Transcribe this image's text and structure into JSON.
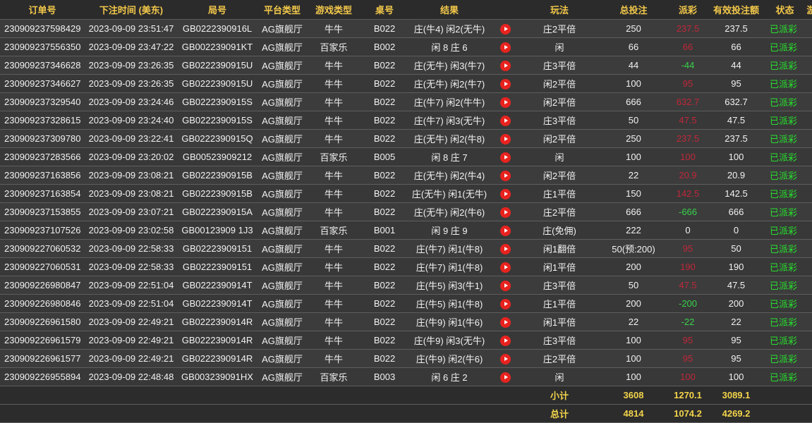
{
  "columns": [
    "订单号",
    "下注时间 (美东)",
    "局号",
    "平台类型",
    "游戏类型",
    "桌号",
    "结果",
    "",
    "玩法",
    "总投注",
    "派彩",
    "有效投注额",
    "状态",
    "游"
  ],
  "rows": [
    {
      "order": "230909237598429",
      "time": "2023-09-09 23:51:47",
      "round": "GB0222390916L",
      "platform": "AG旗舰厅",
      "game": "牛牛",
      "table": "B022",
      "result": "庄(牛4) 闲2(无牛)",
      "play": "庄2平倍",
      "bet": "250",
      "payout": "237.5",
      "payout_sign": "pos",
      "valid": "237.5",
      "status": "已派彩"
    },
    {
      "order": "230909237556350",
      "time": "2023-09-09 23:47:22",
      "round": "GB002239091KT",
      "platform": "AG旗舰厅",
      "game": "百家乐",
      "table": "B002",
      "result": "闲 8 庄 6",
      "play": "闲",
      "bet": "66",
      "payout": "66",
      "payout_sign": "pos",
      "valid": "66",
      "status": "已派彩"
    },
    {
      "order": "230909237346628",
      "time": "2023-09-09 23:26:35",
      "round": "GB0222390915U",
      "platform": "AG旗舰厅",
      "game": "牛牛",
      "table": "B022",
      "result": "庄(无牛) 闲3(牛7)",
      "play": "庄3平倍",
      "bet": "44",
      "payout": "-44",
      "payout_sign": "neg",
      "valid": "44",
      "status": "已派彩"
    },
    {
      "order": "230909237346627",
      "time": "2023-09-09 23:26:35",
      "round": "GB0222390915U",
      "platform": "AG旗舰厅",
      "game": "牛牛",
      "table": "B022",
      "result": "庄(无牛) 闲2(牛7)",
      "play": "闲2平倍",
      "bet": "100",
      "payout": "95",
      "payout_sign": "pos",
      "valid": "95",
      "status": "已派彩"
    },
    {
      "order": "230909237329540",
      "time": "2023-09-09 23:24:46",
      "round": "GB0222390915S",
      "platform": "AG旗舰厅",
      "game": "牛牛",
      "table": "B022",
      "result": "庄(牛7) 闲2(牛牛)",
      "play": "闲2平倍",
      "bet": "666",
      "payout": "632.7",
      "payout_sign": "pos",
      "valid": "632.7",
      "status": "已派彩"
    },
    {
      "order": "230909237328615",
      "time": "2023-09-09 23:24:40",
      "round": "GB0222390915S",
      "platform": "AG旗舰厅",
      "game": "牛牛",
      "table": "B022",
      "result": "庄(牛7) 闲3(无牛)",
      "play": "庄3平倍",
      "bet": "50",
      "payout": "47.5",
      "payout_sign": "pos",
      "valid": "47.5",
      "status": "已派彩"
    },
    {
      "order": "230909237309780",
      "time": "2023-09-09 23:22:41",
      "round": "GB0222390915Q",
      "platform": "AG旗舰厅",
      "game": "牛牛",
      "table": "B022",
      "result": "庄(无牛) 闲2(牛8)",
      "play": "闲2平倍",
      "bet": "250",
      "payout": "237.5",
      "payout_sign": "pos",
      "valid": "237.5",
      "status": "已派彩"
    },
    {
      "order": "230909237283566",
      "time": "2023-09-09 23:20:02",
      "round": "GB00523909212",
      "platform": "AG旗舰厅",
      "game": "百家乐",
      "table": "B005",
      "result": "闲 8 庄 7",
      "play": "闲",
      "bet": "100",
      "payout": "100",
      "payout_sign": "pos",
      "valid": "100",
      "status": "已派彩"
    },
    {
      "order": "230909237163856",
      "time": "2023-09-09 23:08:21",
      "round": "GB0222390915B",
      "platform": "AG旗舰厅",
      "game": "牛牛",
      "table": "B022",
      "result": "庄(无牛) 闲2(牛4)",
      "play": "闲2平倍",
      "bet": "22",
      "payout": "20.9",
      "payout_sign": "pos",
      "valid": "20.9",
      "status": "已派彩"
    },
    {
      "order": "230909237163854",
      "time": "2023-09-09 23:08:21",
      "round": "GB0222390915B",
      "platform": "AG旗舰厅",
      "game": "牛牛",
      "table": "B022",
      "result": "庄(无牛) 闲1(无牛)",
      "play": "庄1平倍",
      "bet": "150",
      "payout": "142.5",
      "payout_sign": "pos",
      "valid": "142.5",
      "status": "已派彩"
    },
    {
      "order": "230909237153855",
      "time": "2023-09-09 23:07:21",
      "round": "GB0222390915A",
      "platform": "AG旗舰厅",
      "game": "牛牛",
      "table": "B022",
      "result": "庄(无牛) 闲2(牛6)",
      "play": "庄2平倍",
      "bet": "666",
      "payout": "-666",
      "payout_sign": "neg",
      "valid": "666",
      "status": "已派彩"
    },
    {
      "order": "230909237107526",
      "time": "2023-09-09 23:02:58",
      "round": "GB00123909 1J3",
      "platform": "AG旗舰厅",
      "game": "百家乐",
      "table": "B001",
      "result": "闲 9 庄 9",
      "play": "庄(免佣)",
      "bet": "222",
      "payout": "0",
      "payout_sign": "zero",
      "valid": "0",
      "status": "已派彩"
    },
    {
      "order": "230909227060532",
      "time": "2023-09-09 22:58:33",
      "round": "GB02223909151",
      "platform": "AG旗舰厅",
      "game": "牛牛",
      "table": "B022",
      "result": "庄(牛7) 闲1(牛8)",
      "play": "闲1翻倍",
      "bet": "50(预:200)",
      "payout": "95",
      "payout_sign": "pos",
      "valid": "50",
      "status": "已派彩"
    },
    {
      "order": "230909227060531",
      "time": "2023-09-09 22:58:33",
      "round": "GB02223909151",
      "platform": "AG旗舰厅",
      "game": "牛牛",
      "table": "B022",
      "result": "庄(牛7) 闲1(牛8)",
      "play": "闲1平倍",
      "bet": "200",
      "payout": "190",
      "payout_sign": "pos",
      "valid": "190",
      "status": "已派彩"
    },
    {
      "order": "230909226980847",
      "time": "2023-09-09 22:51:04",
      "round": "GB0222390914T",
      "platform": "AG旗舰厅",
      "game": "牛牛",
      "table": "B022",
      "result": "庄(牛5) 闲3(牛1)",
      "play": "庄3平倍",
      "bet": "50",
      "payout": "47.5",
      "payout_sign": "pos",
      "valid": "47.5",
      "status": "已派彩"
    },
    {
      "order": "230909226980846",
      "time": "2023-09-09 22:51:04",
      "round": "GB0222390914T",
      "platform": "AG旗舰厅",
      "game": "牛牛",
      "table": "B022",
      "result": "庄(牛5) 闲1(牛8)",
      "play": "庄1平倍",
      "bet": "200",
      "payout": "-200",
      "payout_sign": "neg",
      "valid": "200",
      "status": "已派彩"
    },
    {
      "order": "230909226961580",
      "time": "2023-09-09 22:49:21",
      "round": "GB0222390914R",
      "platform": "AG旗舰厅",
      "game": "牛牛",
      "table": "B022",
      "result": "庄(牛9) 闲1(牛6)",
      "play": "闲1平倍",
      "bet": "22",
      "payout": "-22",
      "payout_sign": "neg",
      "valid": "22",
      "status": "已派彩"
    },
    {
      "order": "230909226961579",
      "time": "2023-09-09 22:49:21",
      "round": "GB0222390914R",
      "platform": "AG旗舰厅",
      "game": "牛牛",
      "table": "B022",
      "result": "庄(牛9) 闲3(无牛)",
      "play": "庄3平倍",
      "bet": "100",
      "payout": "95",
      "payout_sign": "pos",
      "valid": "95",
      "status": "已派彩"
    },
    {
      "order": "230909226961577",
      "time": "2023-09-09 22:49:21",
      "round": "GB0222390914R",
      "platform": "AG旗舰厅",
      "game": "牛牛",
      "table": "B022",
      "result": "庄(牛9) 闲2(牛6)",
      "play": "庄2平倍",
      "bet": "100",
      "payout": "95",
      "payout_sign": "pos",
      "valid": "95",
      "status": "已派彩"
    },
    {
      "order": "230909226955894",
      "time": "2023-09-09 22:48:48",
      "round": "GB003239091HX",
      "platform": "AG旗舰厅",
      "game": "百家乐",
      "table": "B003",
      "result": "闲 6 庄 2",
      "play": "闲",
      "bet": "100",
      "payout": "100",
      "payout_sign": "pos",
      "valid": "100",
      "status": "已派彩"
    }
  ],
  "subtotal": {
    "label": "小计",
    "bet": "3608",
    "payout": "1270.1",
    "valid": "3089.1"
  },
  "total": {
    "label": "总计",
    "bet": "4814",
    "payout": "1074.2",
    "valid": "4269.2"
  },
  "colors": {
    "header_text": "#f3c84a",
    "status_green": "#27e02d",
    "payout_negative": "#37d24a",
    "payout_positive": "#c0273a",
    "play_icon": "#e8231f"
  },
  "icons": {
    "result_action": "play-circle-icon"
  }
}
